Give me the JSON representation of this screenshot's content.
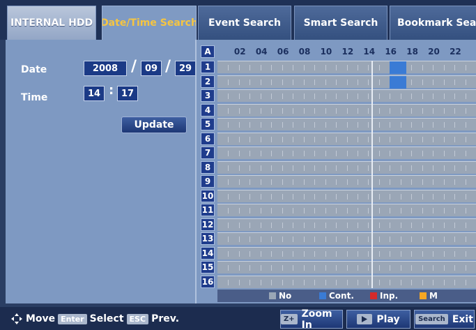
{
  "tabs": [
    {
      "label": "INTERNAL HDD"
    },
    {
      "label": "Date/Time Search"
    },
    {
      "label": "Event Search"
    },
    {
      "label": "Smart Search"
    },
    {
      "label": "Bookmark Search"
    }
  ],
  "form": {
    "date_label": "Date",
    "year": "2008",
    "month": "09",
    "day": "29",
    "date_sep": "/",
    "time_label": "Time",
    "hour": "14",
    "minute": "17",
    "time_sep": ":",
    "update_label": "Update"
  },
  "timeline": {
    "all_label": "A",
    "hours": [
      "02",
      "04",
      "06",
      "08",
      "10",
      "12",
      "14",
      "16",
      "18",
      "20",
      "22"
    ],
    "channels": [
      "1",
      "2",
      "3",
      "4",
      "5",
      "6",
      "7",
      "8",
      "9",
      "10",
      "11",
      "12",
      "13",
      "14",
      "15",
      "16"
    ],
    "cursor_hour": 14.3,
    "recordings": [
      {
        "channel": "1",
        "start_hour": 16.0,
        "end_hour": 17.5,
        "type": "Cont."
      },
      {
        "channel": "2",
        "start_hour": 16.0,
        "end_hour": 17.5,
        "type": "Cont."
      }
    ]
  },
  "legend": [
    {
      "label": "No",
      "color": "#9aa6b6"
    },
    {
      "label": "Cont.",
      "color": "#3a7bd5"
    },
    {
      "label": "Inp.",
      "color": "#d62a2a"
    },
    {
      "label": "M",
      "color": "#f5a623"
    }
  ],
  "bottombar": {
    "move_label": "Move",
    "enter_key": "Enter",
    "select_label": "Select",
    "esc_key": "ESC",
    "prev_label": "Prev.",
    "zoom_key": "Z+",
    "zoom_label": "Zoom In",
    "play_label": "Play",
    "search_key": "Search",
    "exit_label": "Exit"
  },
  "colors": {
    "accent_tab_text": "#f5c542",
    "field_bg": "#1b3a86",
    "recording": "#3a7bd5"
  }
}
